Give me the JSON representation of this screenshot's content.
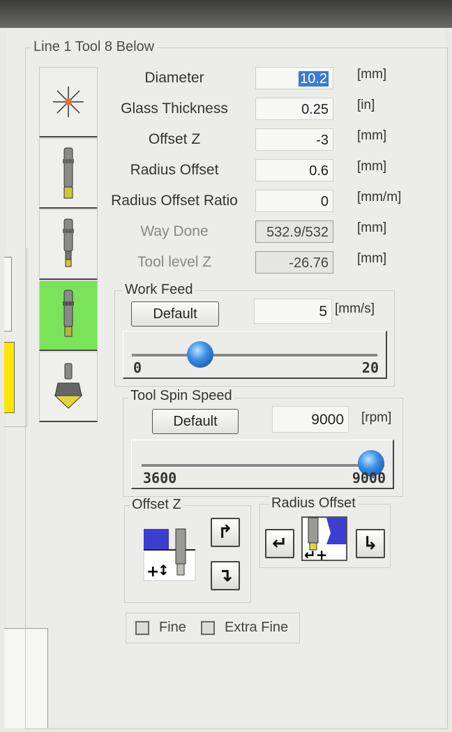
{
  "window": {
    "group_title": "Line 1 Tool 8 Below"
  },
  "tabs": [
    {
      "name": "laser-icon",
      "active": false
    },
    {
      "name": "tool-long-icon",
      "active": false
    },
    {
      "name": "tool-short-icon",
      "active": false
    },
    {
      "name": "tool-mid-icon",
      "active": true
    },
    {
      "name": "tool-cone-icon",
      "active": false
    }
  ],
  "params": [
    {
      "label": "Diameter",
      "value": "10.2",
      "unit": "[mm]",
      "readonly": false,
      "selected": true
    },
    {
      "label": "Glass Thickness",
      "value": "0.25",
      "unit": "[in]",
      "readonly": false
    },
    {
      "label": "Offset Z",
      "value": "-3",
      "unit": "[mm]",
      "readonly": false
    },
    {
      "label": "Radius Offset",
      "value": "0.6",
      "unit": "[mm]",
      "readonly": false
    },
    {
      "label": "Radius Offset Ratio",
      "value": "0",
      "unit": "[mm/m]",
      "readonly": false
    },
    {
      "label": "Way Done",
      "value": "532.9/532",
      "unit": "[mm]",
      "readonly": true
    },
    {
      "label": "Tool level Z",
      "value": "-26.76",
      "unit": "[mm]",
      "readonly": true
    }
  ],
  "work_feed": {
    "title": "Work Feed",
    "default_label": "Default",
    "value": "5",
    "unit": "[mm/s]",
    "slider_min": "0",
    "slider_max": "20",
    "slider_fraction": 0.25
  },
  "spin_speed": {
    "title": "Tool Spin Speed",
    "default_label": "Default",
    "value": "9000",
    "unit": "[rpm]",
    "slider_min": "3600",
    "slider_max": "9000",
    "slider_fraction": 1.0
  },
  "offset_z": {
    "title": "Offset Z",
    "up_icon": "arrow-up-icon",
    "down_icon": "arrow-down-icon"
  },
  "radius_offset": {
    "title": "Radius Offset",
    "left_icon": "arrow-left-icon",
    "right_icon": "arrow-right-icon"
  },
  "options": {
    "fine_label": "Fine",
    "extra_fine_label": "Extra Fine",
    "fine_checked": false,
    "extra_fine_checked": false
  },
  "colors": {
    "active_tab": "#7be35a",
    "knob": "#3b8fe6",
    "side_marker": "#ffe600"
  }
}
